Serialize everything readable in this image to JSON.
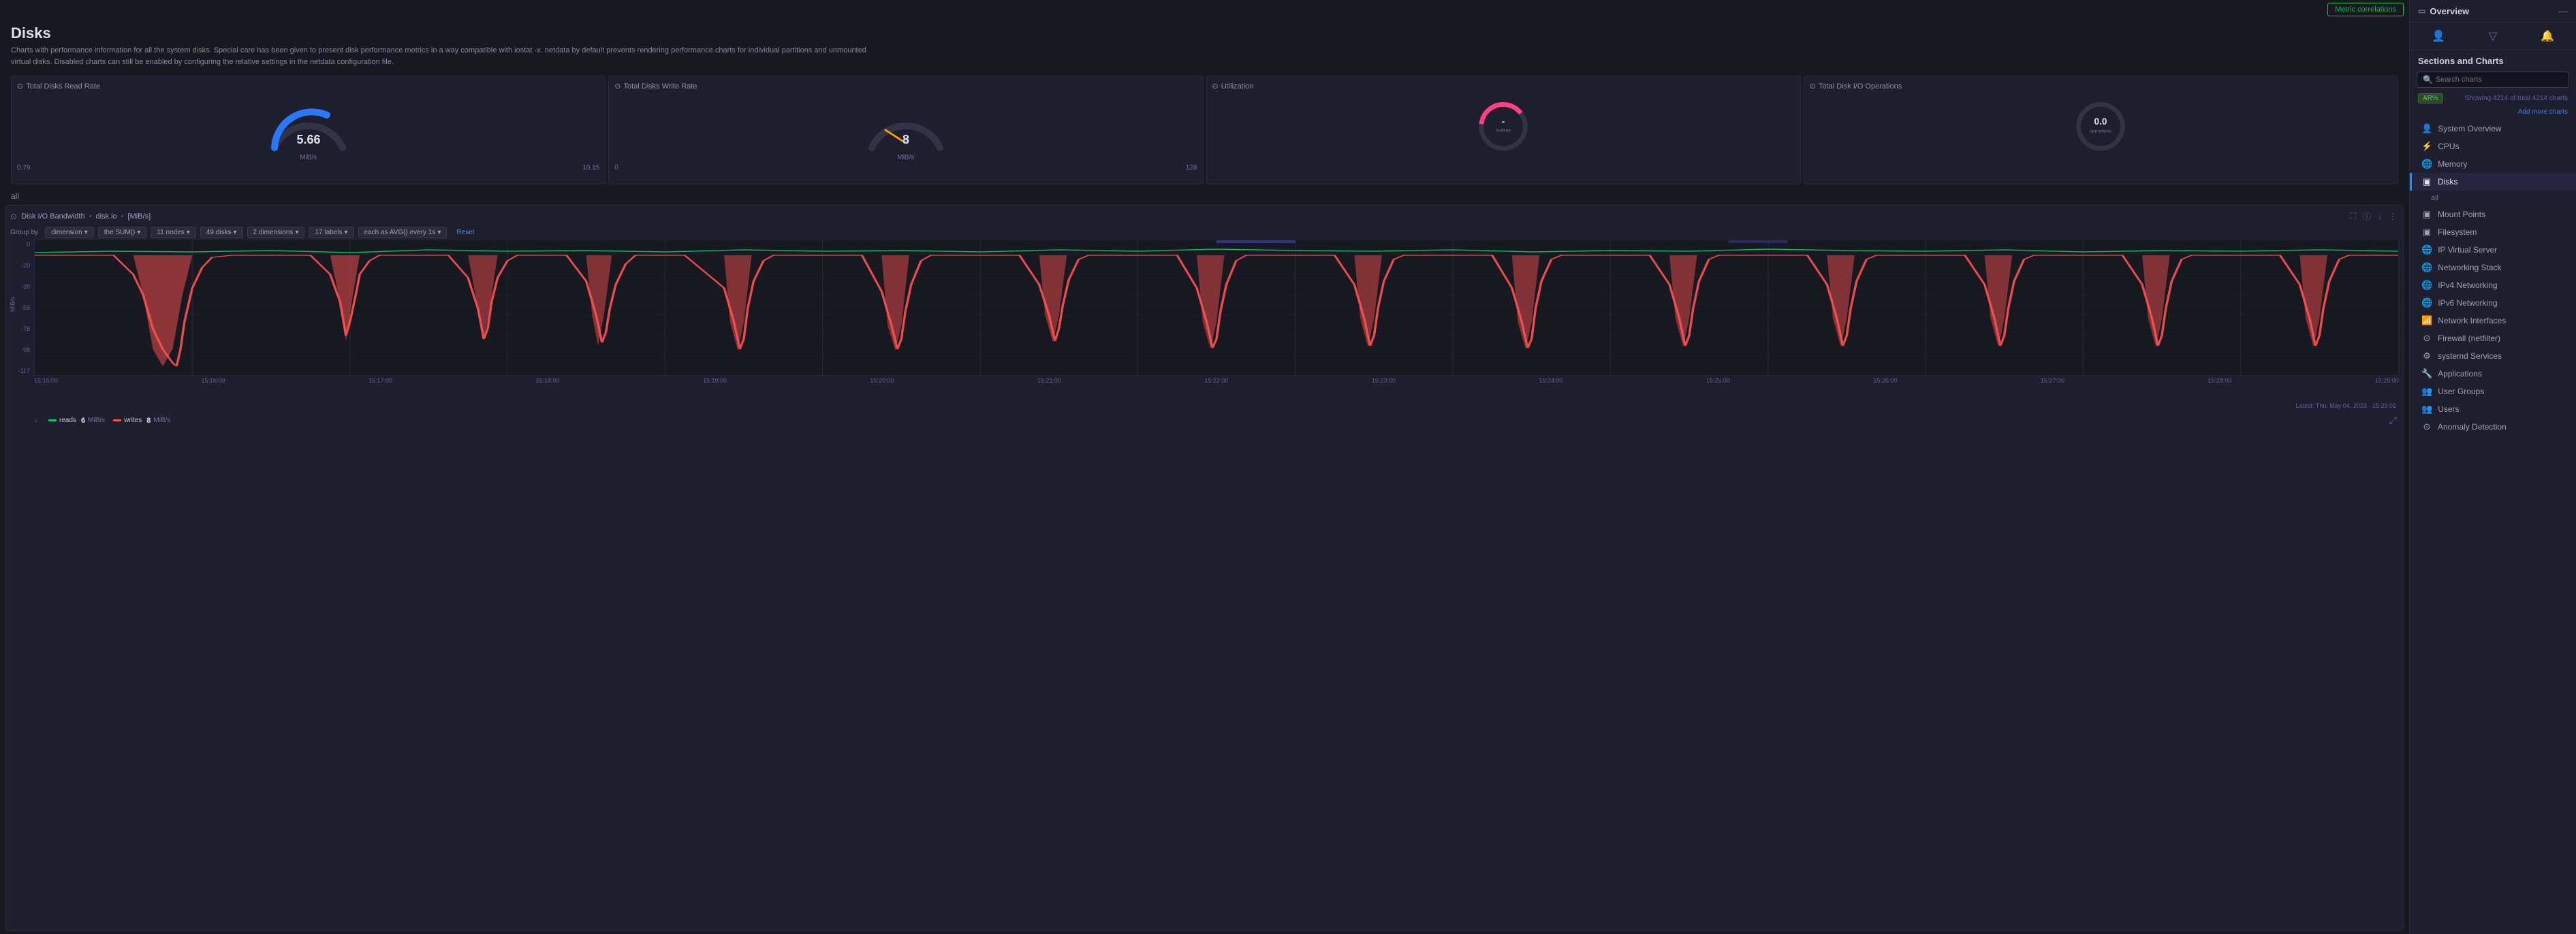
{
  "topbar": {
    "metric_correlations": "Metric correlations"
  },
  "page": {
    "title": "Disks",
    "description": "Charts with performance information for all the system disks. Special care has been given to present disk performance metrics in a way compatible with iostat -x. netdata by default prevents rendering performance charts for individual partitions and unmounted virtual disks. Disabled charts can still be enabled by configuring the relative settings in the netdata configuration file."
  },
  "gauges": [
    {
      "title": "Total Disks Read Rate",
      "value": "5.66",
      "unit": "MiB/s",
      "min": "0.79",
      "max": "10.15",
      "arc_color": "blue",
      "type": "semicircle"
    },
    {
      "title": "Total Disks Write Rate",
      "value": "8",
      "unit": "MiB/s",
      "min": "0",
      "max": "128",
      "arc_color": "orange",
      "type": "semicircle"
    },
    {
      "title": "Utilization",
      "value": "-",
      "subtext": "%ofime",
      "unit": "",
      "type": "circle_pink"
    },
    {
      "title": "Total Disk I/O Operations",
      "value": "0.0",
      "subtext": "operations",
      "unit": "",
      "type": "semicircle_gray"
    }
  ],
  "section_label": "all",
  "chart": {
    "icon": "⊙",
    "title_parts": [
      "Disk I/O Bandwidth",
      "disk.io",
      "[MiB/s]"
    ],
    "group_by": "dimension",
    "aggregation": "the SUM()",
    "nodes": "11 nodes",
    "disks": "49 disks",
    "dimensions": "2 dimensions",
    "labels": "17 labels",
    "each_as": "each as AVG() every 1s",
    "reset": "Reset",
    "ar_label": "AR",
    "y_labels": [
      "0",
      "-20",
      "-39",
      "-59",
      "-78",
      "-98",
      "-117"
    ],
    "axis_unit": "MiB/s",
    "x_labels": [
      "15:15:00",
      "15:16:00",
      "15:17:00",
      "15:18:00",
      "15:19:00",
      "15:20:00",
      "15:21:00",
      "15:22:00",
      "15:23:00",
      "15:24:00",
      "15:25:00",
      "15:26:00",
      "15:27:00",
      "15:28:00",
      "15:29:00"
    ],
    "timestamp": "Latest: Thu, May 04, 2023 · 15:29:02",
    "legend": [
      {
        "label": "reads",
        "value": "6",
        "unit": "MiB/s",
        "color": "#00cc66"
      },
      {
        "label": "writes",
        "value": "8",
        "unit": "MiB/s",
        "color": "#ff5252"
      }
    ]
  },
  "sidebar": {
    "overview_label": "Overview",
    "sections_title": "Sections and Charts",
    "search_placeholder": "Search charts",
    "filter_badge": "AR%",
    "showing_text": "Showing 4214 of total 4214 charts",
    "add_charts": "Add more charts",
    "nav_items": [
      {
        "id": "system-overview",
        "label": "System Overview",
        "icon": "👤",
        "active": false
      },
      {
        "id": "cpus",
        "label": "CPUs",
        "icon": "⚡",
        "active": false
      },
      {
        "id": "memory",
        "label": "Memory",
        "icon": "🌐",
        "active": false
      },
      {
        "id": "disks",
        "label": "Disks",
        "icon": "▣",
        "active": true
      },
      {
        "id": "disks-all",
        "label": "all",
        "icon": "",
        "active": false,
        "sub": true
      },
      {
        "id": "mount-points",
        "label": "Mount Points",
        "icon": "▣",
        "active": false
      },
      {
        "id": "filesystem",
        "label": "Filesystem",
        "icon": "▣",
        "active": false
      },
      {
        "id": "ip-virtual-server",
        "label": "IP Virtual Server",
        "icon": "🌐",
        "active": false
      },
      {
        "id": "networking-stack",
        "label": "Networking Stack",
        "icon": "🌐",
        "active": false
      },
      {
        "id": "ipv4-networking",
        "label": "IPv4 Networking",
        "icon": "🌐",
        "active": false
      },
      {
        "id": "ipv6-networking",
        "label": "IPv6 Networking",
        "icon": "🌐",
        "active": false
      },
      {
        "id": "network-interfaces",
        "label": "Network Interfaces",
        "icon": "📶",
        "active": false
      },
      {
        "id": "firewall",
        "label": "Firewall (netfilter)",
        "icon": "⊙",
        "active": false
      },
      {
        "id": "systemd-services",
        "label": "systemd Services",
        "icon": "⚙",
        "active": false
      },
      {
        "id": "applications",
        "label": "Applications",
        "icon": "🔧",
        "active": false
      },
      {
        "id": "user-groups",
        "label": "User Groups",
        "icon": "👥",
        "active": false
      },
      {
        "id": "users",
        "label": "Users",
        "icon": "👥",
        "active": false
      },
      {
        "id": "anomaly-detection",
        "label": "Anomaly Detection",
        "icon": "⊙",
        "active": false
      }
    ]
  }
}
